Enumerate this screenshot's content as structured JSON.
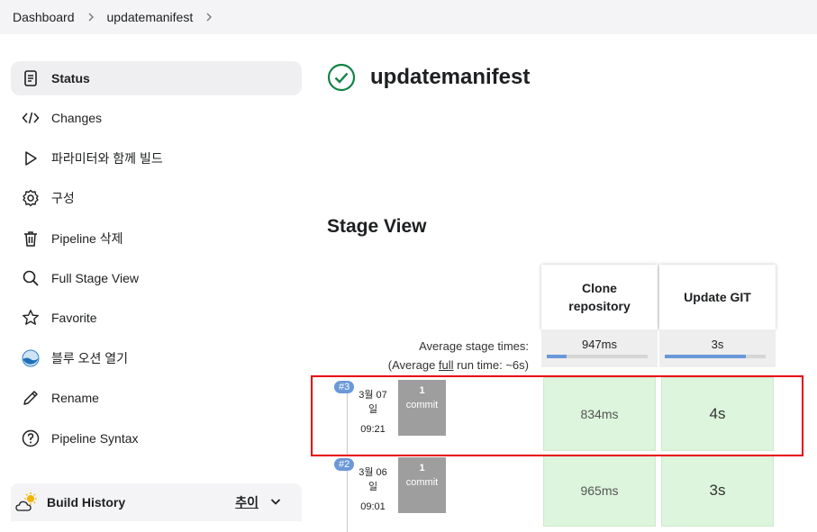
{
  "breadcrumb": {
    "items": [
      "Dashboard",
      "updatemanifest"
    ]
  },
  "sidebar": {
    "items": [
      {
        "label": "Status",
        "icon": "document-icon",
        "active": true
      },
      {
        "label": "Changes",
        "icon": "code-icon"
      },
      {
        "label": "파라미터와 함께 빌드",
        "icon": "play-icon"
      },
      {
        "label": "구성",
        "icon": "gear-icon"
      },
      {
        "label": "Pipeline 삭제",
        "icon": "trash-icon"
      },
      {
        "label": "Full Stage View",
        "icon": "search-icon"
      },
      {
        "label": "Favorite",
        "icon": "star-icon"
      },
      {
        "label": "블루 오션 열기",
        "icon": "blue-ocean-icon"
      },
      {
        "label": "Rename",
        "icon": "pencil-icon"
      },
      {
        "label": "Pipeline Syntax",
        "icon": "help-icon"
      }
    ],
    "build_history": {
      "title": "Build History",
      "trend_label": "추이"
    }
  },
  "main": {
    "job_title": "updatemanifest",
    "status": "success",
    "stage_view_title": "Stage View",
    "stage_view": {
      "columns": [
        "Clone\nrepository",
        "Update GIT"
      ],
      "average_label": "Average stage times:",
      "average_run_prefix": "(Average ",
      "average_run_link": "full",
      "average_run_suffix": " run time: ~6s)",
      "averages": [
        {
          "value": "947ms",
          "fill_percent": 20
        },
        {
          "value": "3s",
          "fill_percent": 80
        }
      ],
      "runs": [
        {
          "badge": "#3",
          "date": "3월 07",
          "day": "일",
          "time": "09:21",
          "commits": "1",
          "commit_label": "commit",
          "stages": [
            "834ms",
            "4s"
          ]
        },
        {
          "badge": "#2",
          "date": "3월 06",
          "day": "일",
          "time": "09:01",
          "commits": "1",
          "commit_label": "commit",
          "stages": [
            "965ms",
            "3s"
          ]
        }
      ]
    }
  },
  "colors": {
    "success": "#138347",
    "accent": "#6a98d8",
    "stage_success": "#dcf5dc",
    "highlight": "#e8000d"
  }
}
